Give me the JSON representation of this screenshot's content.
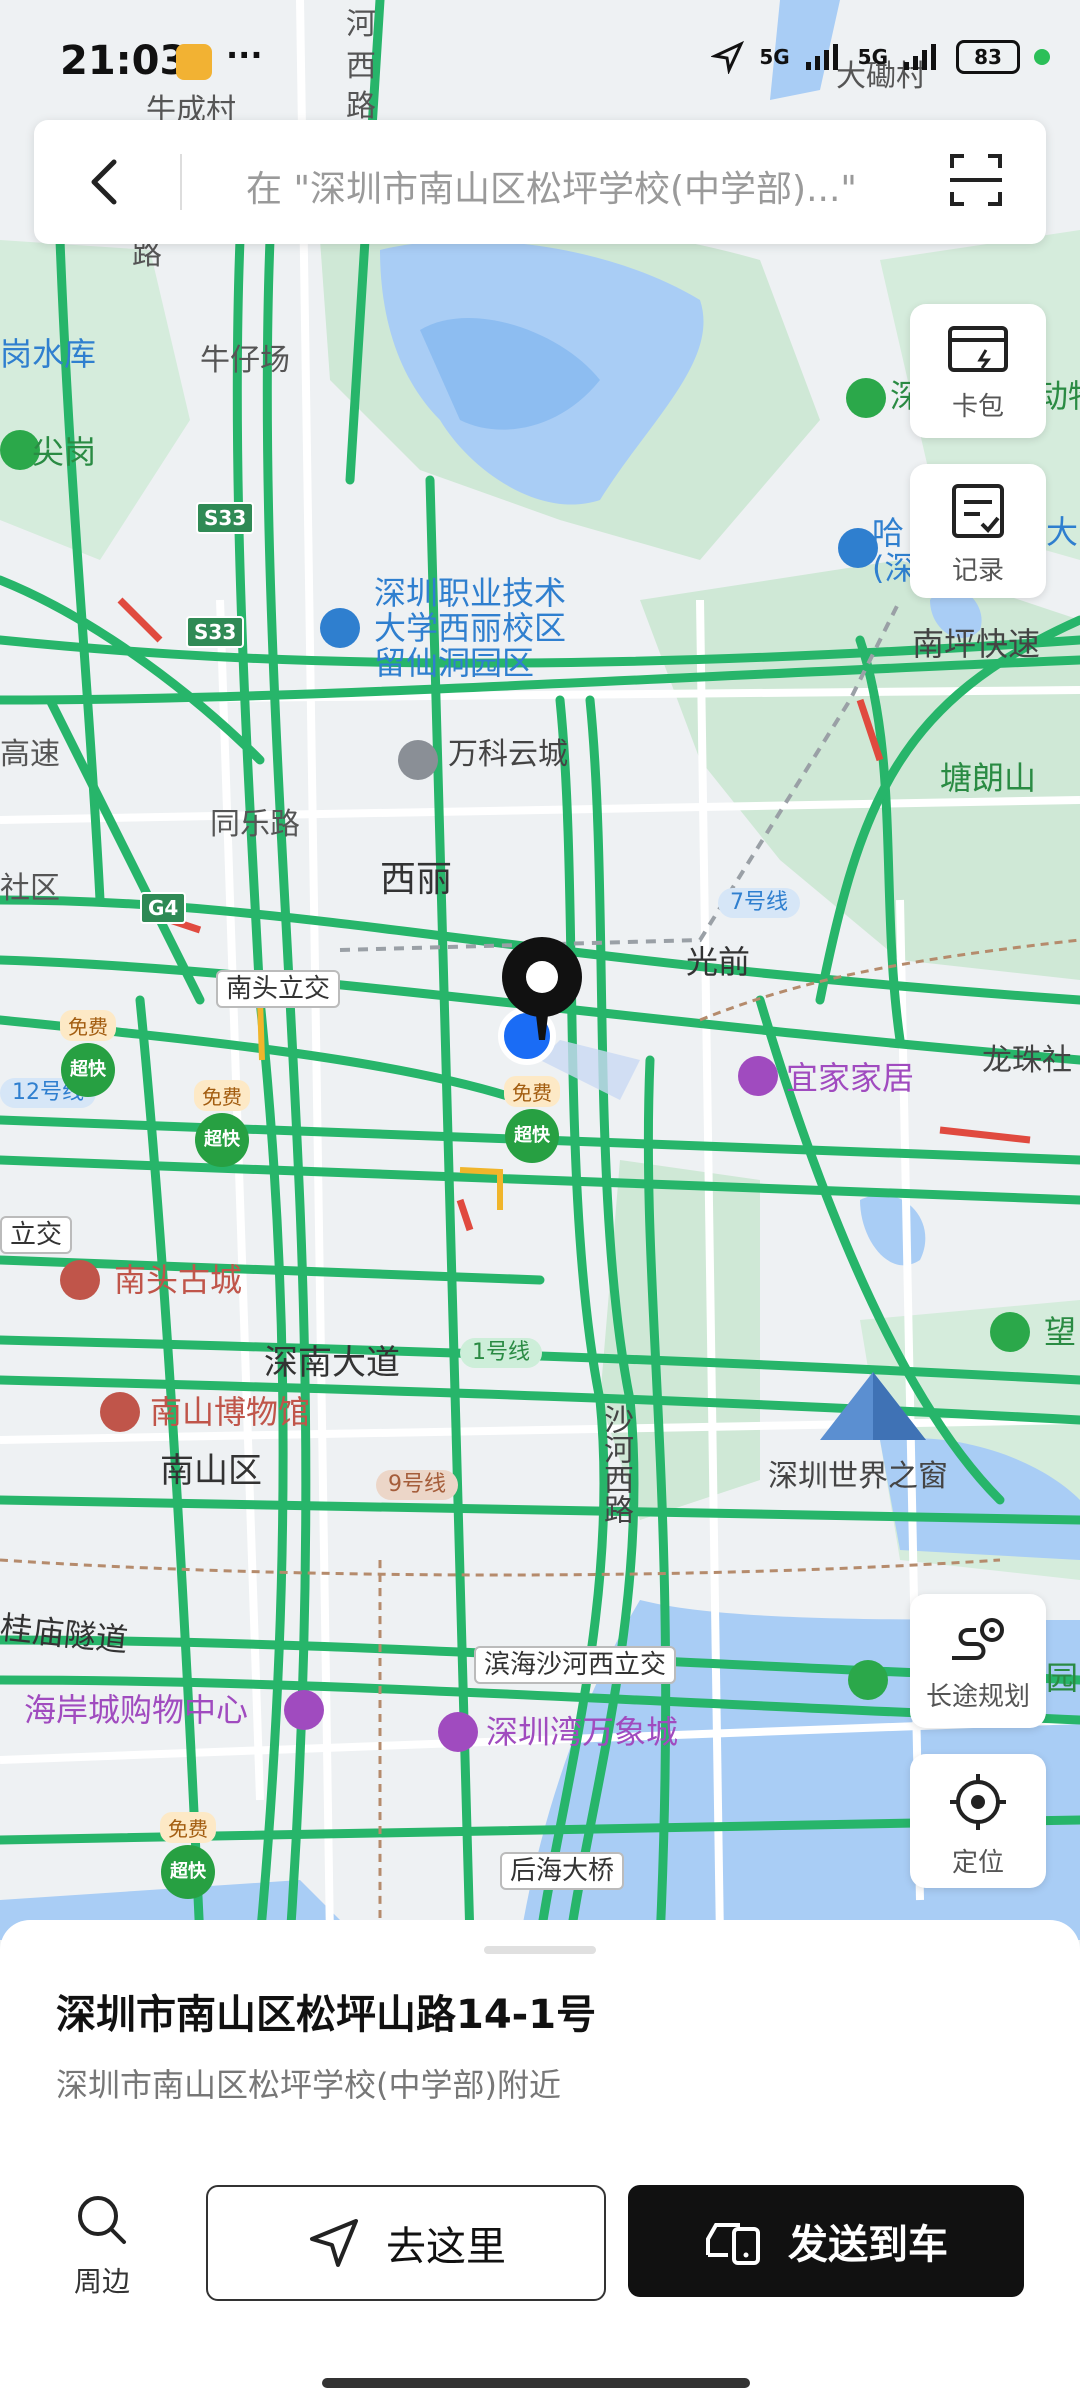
{
  "status_bar": {
    "time": "21:03",
    "dots": "···",
    "signal1": "5G",
    "signal2": "5G",
    "battery": "83"
  },
  "search": {
    "placeholder": "在 \"深圳市南山区松坪学校(中学部)...\""
  },
  "map": {
    "labels": {
      "shengcheng": "牛成村",
      "dadanmu": "大磡村",
      "hexi1": "河",
      "hexi2": "西",
      "hexi3": "路",
      "lu_top": "路",
      "gangang_reservoir": "岗水库",
      "niuzaichang": "牛仔场",
      "jiangang": "尖岗",
      "shenzhen_vocational": "深圳职业技术\n大学西丽校区\n留仙洞园区",
      "hagong": "哈\n(深",
      "vanke": "万科云城",
      "nanping": "南坪快速",
      "tanglang": "塘朗山",
      "gaosu": "高速",
      "tongle": "同乐路",
      "shequ": "社区",
      "xili": "西丽",
      "line7": "7号线",
      "nantou_interchange": "南头立交",
      "guangqian": "光前",
      "line12": "12号线",
      "yijia": "宜家家居",
      "longzhu": "龙珠社",
      "lijiao": "立交",
      "nantou_old": "南头古城",
      "wang": "望",
      "shennan": "深南大道",
      "line1": "1号线",
      "museum": "南山博物馆",
      "shahexi": "沙河西路",
      "nanshan_district": "南山区",
      "line9": "9号线",
      "window": "深圳世界之窗",
      "guimiao": "桂庙隧道",
      "binhai": "滨海沙河西立交",
      "haian": "海岸城购物中心",
      "mixc": "深圳湾万象城",
      "houhai": "后海大桥",
      "free": "免费",
      "chaokuai": "超快",
      "s33": "S33",
      "g4": "G4",
      "dongwu": "动物",
      "shen": "深",
      "da": "大",
      "yuan": "园"
    }
  },
  "side_buttons": {
    "card": "卡包",
    "record": "记录",
    "long_trip": "长途规划",
    "locate": "定位"
  },
  "place": {
    "title": "深圳市南山区松坪山路14-1号",
    "subtitle": "深圳市南山区松坪学校(中学部)附近"
  },
  "actions": {
    "nearby": "周边",
    "go_here": "去这里",
    "send_to_car": "发送到车"
  }
}
